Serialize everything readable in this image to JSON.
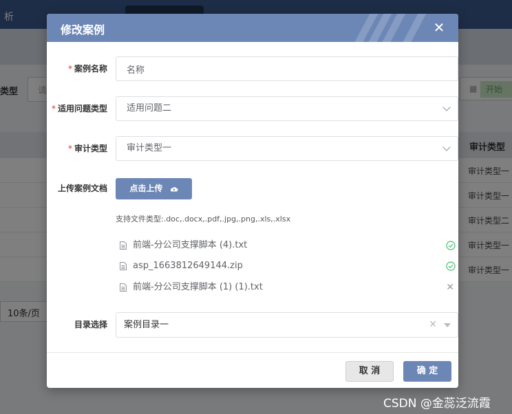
{
  "background": {
    "tabs": [
      "析",
      "",
      ""
    ],
    "filter_label": "类型",
    "filter_placeholder": "请",
    "date_button": "开始",
    "column_header": "审计类型",
    "rows": [
      "审计类型一",
      "审计类型一",
      "审计类型二",
      "审计类型一",
      "审计类型一"
    ],
    "page_size": "10条/页"
  },
  "dialog": {
    "title": "修改案例",
    "close_icon": "close-icon",
    "fields": {
      "case_name": {
        "label": "案例名称",
        "required_mark": "*",
        "value": "名称"
      },
      "problem_type": {
        "label": "适用问题类型",
        "required_mark": "*",
        "value": "适用问题二"
      },
      "audit_type": {
        "label": "审计类型",
        "required_mark": "*",
        "value": "审计类型一"
      },
      "upload": {
        "label": "上传案例文档",
        "button_label": "点击上传",
        "tip": "支持文件类型:.doc,.docx,.pdf,.jpg,.png,.xls,.xlsx",
        "files": [
          {
            "name": "前端-分公司支撑脚本 (4).txt",
            "status": "success"
          },
          {
            "name": "asp_1663812649144.zip",
            "status": "success"
          },
          {
            "name": "前端-分公司支撑脚本 (1) (1).txt",
            "status": "remove"
          }
        ]
      },
      "directory": {
        "label": "目录选择",
        "value": "案例目录一"
      }
    },
    "footer": {
      "cancel_label": "取 消",
      "ok_label": "确 定"
    }
  },
  "watermark": "CSDN @金蕊泛流霞",
  "colors": {
    "header": "#6c87b5",
    "success": "#3fbf6f",
    "required": "#e0322b"
  }
}
